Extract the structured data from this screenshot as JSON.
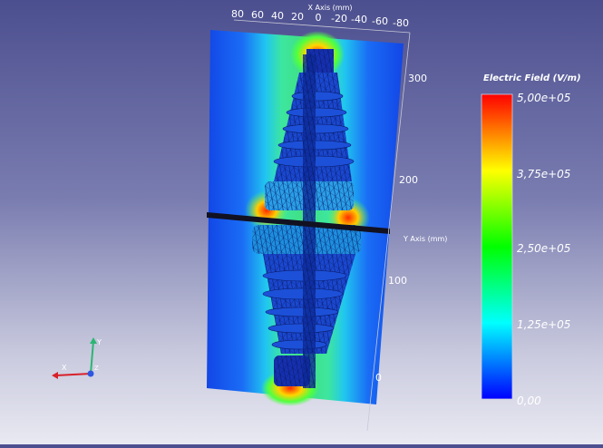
{
  "scene": {
    "x_axis": {
      "title": "X Axis (mm)",
      "ticks": [
        "80",
        "60",
        "40",
        "20",
        "0",
        "-20",
        "-40",
        "-60",
        "-80"
      ]
    },
    "y_axis": {
      "title": "Y Axis (mm)",
      "ticks": [
        "300",
        "200",
        "100",
        "0"
      ]
    },
    "orientation_widget": {
      "x_label": "X",
      "y_label": "Y",
      "z_label": "Z",
      "colors": {
        "x": "#d8202a",
        "y": "#2bb673",
        "z": "#2f56e0"
      }
    }
  },
  "colorbar": {
    "title": "Electric Field (V/m)",
    "labels": [
      "5,00e+05",
      "3,75e+05",
      "2,50e+05",
      "1,25e+05",
      "0,00"
    ],
    "range": [
      0,
      500000
    ],
    "colors": [
      "#0000ff",
      "#00ffff",
      "#00ff00",
      "#ffff00",
      "#ff0000"
    ]
  }
}
